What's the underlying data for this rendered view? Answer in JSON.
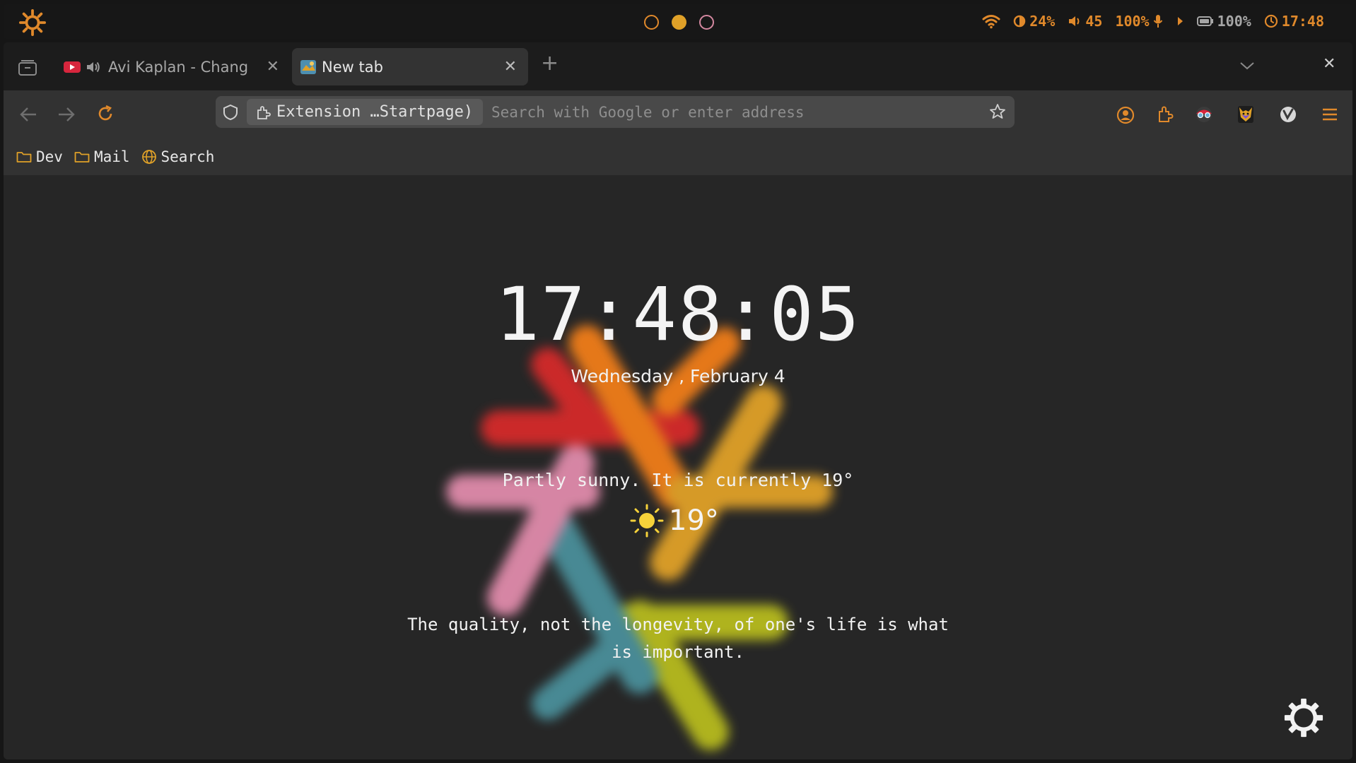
{
  "system_bar": {
    "logo_icon": "sun-gear-icon",
    "workspaces": [
      {
        "state": "empty",
        "color": "#e0892b"
      },
      {
        "state": "active",
        "color": "#e0a128"
      },
      {
        "state": "empty",
        "color": "#d488a0"
      }
    ],
    "brightness": "24%",
    "volume": "45",
    "mic": "100%",
    "battery": "100%",
    "time": "17:48"
  },
  "tabs": [
    {
      "title": "Avi Kaplan - Chang",
      "favicon": "youtube-icon",
      "audio": true,
      "active": false
    },
    {
      "title": "New tab",
      "favicon": "newtab-icon",
      "active": true
    }
  ],
  "urlbar": {
    "extension_label": "Extension …Startpage)",
    "placeholder": "Search with Google or enter address"
  },
  "bookmarks": [
    {
      "label": "Dev",
      "icon": "folder-icon"
    },
    {
      "label": "Mail",
      "icon": "folder-icon"
    },
    {
      "label": "Search",
      "icon": "globe-icon"
    }
  ],
  "startpage": {
    "clock": "17:48:05",
    "date": "Wednesday , February 4",
    "weather_text": "Partly sunny. It is currently 19°",
    "temperature": "19°",
    "quote": "The quality, not the longevity, of one's life is what is important."
  },
  "colors": {
    "accent": "#e0892b",
    "background": "#262626",
    "toolbar": "#323232"
  }
}
